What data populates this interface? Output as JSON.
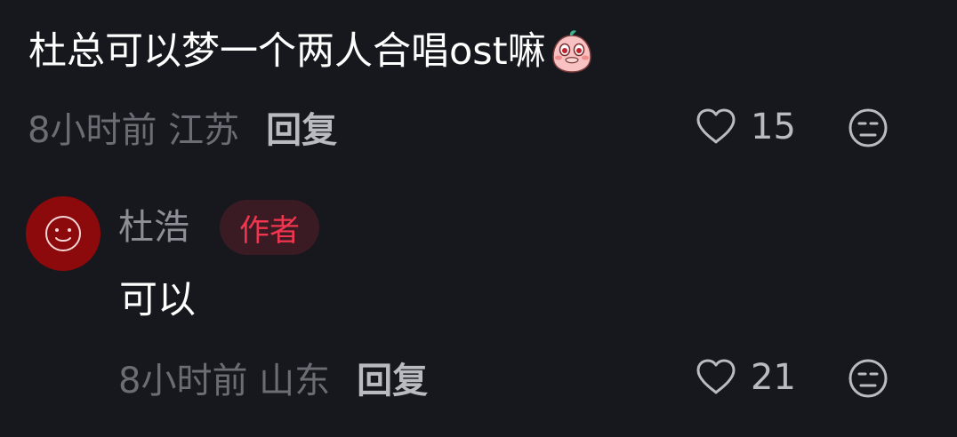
{
  "comment": {
    "text": "杜总可以梦一个两人合唱ost嘛",
    "emoji": "blushing-peach-sticker",
    "time_location": "8小时前 江苏",
    "reply_label": "回复",
    "like_count": "15"
  },
  "reply": {
    "author": "杜浩",
    "badge": "作者",
    "text": "可以",
    "time_location": "8小时前 山东",
    "reply_label": "回复",
    "like_count": "21"
  },
  "colors": {
    "background": "#17181d",
    "badge_text": "#f0364f",
    "badge_bg": "#3a1b23",
    "avatar_bg": "#8c0a0c"
  },
  "icons": {
    "like": "heart-outline-icon",
    "dislike": "neutral-face-icon",
    "avatar": "smiley-face-icon"
  }
}
